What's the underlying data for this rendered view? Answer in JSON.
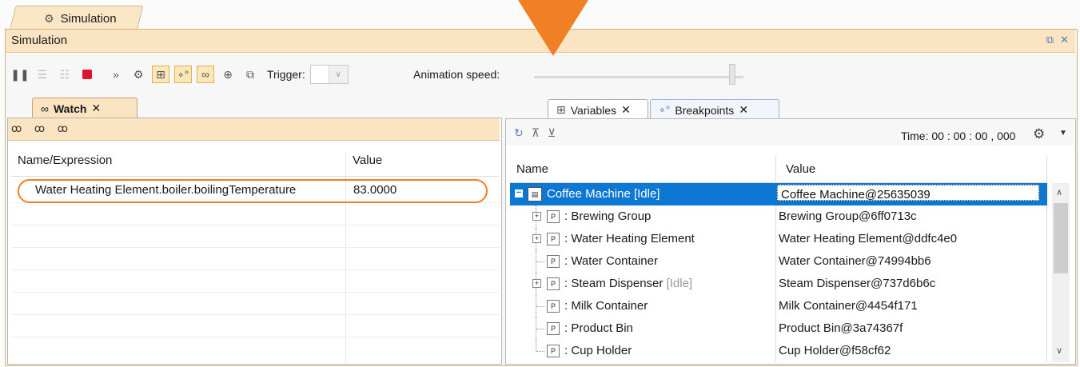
{
  "top_tab": {
    "label": "Simulation",
    "icon": "simulation-gear-icon"
  },
  "sim_panel": {
    "title": "Simulation",
    "restore": "⧉",
    "close": "✕"
  },
  "toolbar": {
    "trigger_label": "Trigger:",
    "animation_label": "Animation speed:",
    "animation_speed": 0.96
  },
  "watch": {
    "tab_label": "Watch",
    "tab_close": "✕",
    "tools": "ꝏ ꝏ ꝏ",
    "headers": {
      "name": "Name/Expression",
      "value": "Value"
    },
    "rows": [
      {
        "expr": "Water Heating Element.boiler.boilingTemperature",
        "value": "83.0000"
      }
    ]
  },
  "variables": {
    "tab_label": "Variables",
    "breakpoints_label": "Breakpoints",
    "tab_close": "✕",
    "time_label": "Time: 00 : 00 : 00 , 000",
    "headers": {
      "name": "Name",
      "value": "Value"
    },
    "rows": [
      {
        "name": "Coffee Machine [Idle]",
        "value": "Coffee Machine@25635039"
      },
      {
        "name": ": Brewing Group",
        "suffix": "",
        "value": "Brewing Group@6ff0713c"
      },
      {
        "name": ": Water Heating Element",
        "suffix": "",
        "value": "Water Heating Element@ddfc4e0"
      },
      {
        "name": ": Water Container",
        "suffix": "",
        "value": "Water Container@74994bb6"
      },
      {
        "name": ": Steam Dispenser",
        "suffix": "[Idle]",
        "value": "Steam Dispenser@737d6b6c"
      },
      {
        "name": ": Milk Container",
        "suffix": "",
        "value": "Milk Container@4454f171"
      },
      {
        "name": ": Product Bin",
        "suffix": "",
        "value": "Product Bin@3a74367f"
      },
      {
        "name": ": Cup Holder",
        "suffix": "",
        "value": "Cup Holder@f58cf62"
      }
    ]
  },
  "colors": {
    "accent": "#f07f25",
    "selection": "#0c78d4",
    "panel_header": "#fbe4c1"
  }
}
